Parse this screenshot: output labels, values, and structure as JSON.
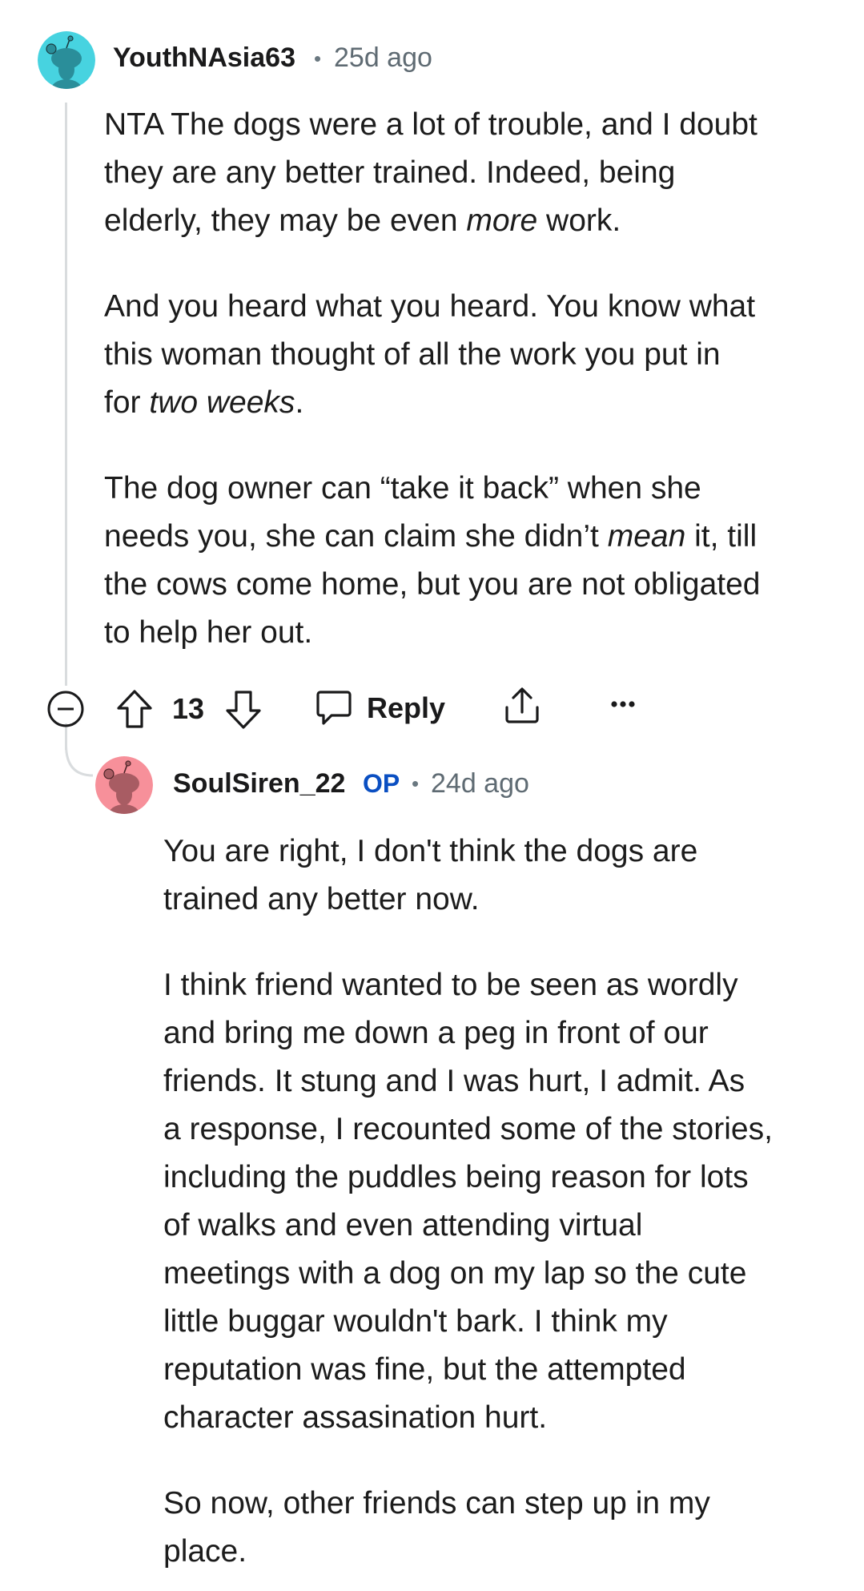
{
  "comments": [
    {
      "username": "YouthNAsia63",
      "separator": "•",
      "time": "25d ago",
      "avatar_icon": "snoo-avatar-icon",
      "avatar_color": "#47d3e0",
      "paragraphs": [
        [
          "NTA The dogs were a lot of trouble, and I doubt",
          "they are any better trained. Indeed, being",
          "elderly, they may be even ",
          "more",
          " work."
        ],
        [
          "And you heard what you heard. You know what",
          "this woman thought of all the work you put in",
          "for ",
          "two weeks",
          "."
        ],
        [
          "The dog owner can “take it back” when she",
          "needs you, she can claim she didn’t ",
          "mean",
          " it, till",
          "the cows come home, but you are not obligated",
          "to help her out."
        ]
      ],
      "actions": {
        "collapse_icon": "collapse-minus-icon",
        "upvote_icon": "upvote-arrow-icon",
        "vote_count": "13",
        "downvote_icon": "downvote-arrow-icon",
        "reply_icon": "comment-bubble-icon",
        "reply_label": "Reply",
        "share_icon": "share-icon",
        "more_icon": "more-options-icon"
      }
    },
    {
      "username": "SoulSiren_22",
      "op_badge": "OP",
      "separator": "•",
      "time": "24d ago",
      "avatar_icon": "snoo-avatar-icon",
      "avatar_color": "#f7909a",
      "paragraphs": [
        [
          "You are right, I don't think the dogs are",
          "trained any better now."
        ],
        [
          "I think friend wanted to be seen as wordly",
          "and bring me down a peg in front of our",
          "friends. It stung and I was hurt, I admit. As",
          "a response, I recounted some of the stories,",
          "including the puddles being reason for lots",
          "of walks and even attending virtual",
          "meetings with a dog on my lap so the cute",
          "little buggar wouldn't bark. I think my",
          "reputation was fine, but the attempted",
          "character assasination hurt."
        ],
        [
          "So now, other friends can step up in my",
          "place."
        ]
      ]
    }
  ]
}
